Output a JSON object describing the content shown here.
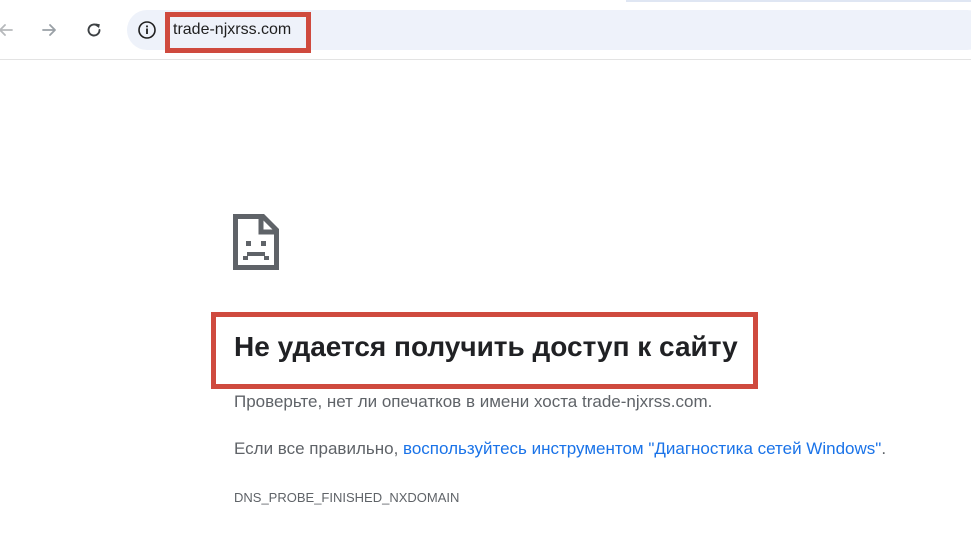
{
  "browser": {
    "url": "trade-njxrss.com",
    "nav": {
      "back_icon": "arrow-left-icon",
      "forward_icon": "arrow-right-icon",
      "reload_icon": "reload-icon",
      "info_icon": "info-circle-icon"
    }
  },
  "error_page": {
    "icon": "sad-page-icon",
    "title": "Не удается получить доступ к сайту",
    "description": "Проверьте, нет ли опечатков в имени хоста trade-njxrss.com.",
    "hint_prefix": "Если все правильно, ",
    "hint_link": "воспользуйтесь инструментом \"Диагностика сетей Windows\"",
    "hint_suffix": ".",
    "error_code": "DNS_PROBE_FINISHED_NXDOMAIN"
  },
  "colors": {
    "highlight": "#cf4a3e",
    "link": "#1a73e8",
    "omnibox_bg": "#eef2fa",
    "title_text": "#202124",
    "body_text": "#5f6368"
  }
}
